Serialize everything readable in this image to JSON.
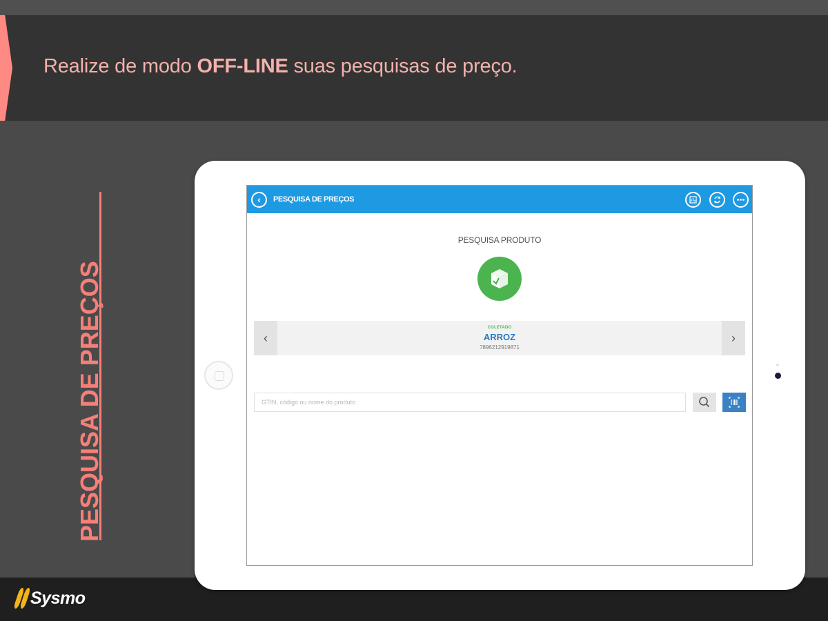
{
  "banner": {
    "text_before": "Realize de modo ",
    "text_bold": "OFF-LINE",
    "text_after": " suas pesquisas de preço."
  },
  "side_title": "PESQUISA DE PREÇOS",
  "brand": {
    "logo_text": "Sysmo"
  },
  "app": {
    "header_title": "PESQUISA DE PREÇOS",
    "section_title": "PESQUISA PRODUTO",
    "product": {
      "status_label": "COLETADO",
      "name": "ARROZ",
      "code": "7896212919871"
    },
    "search": {
      "placeholder": "GTIN, código ou nome do produto",
      "value": ""
    },
    "icons": {
      "back": "back-arrow-icon",
      "header_actions": [
        "chart-icon",
        "sync-icon",
        "more-icon"
      ],
      "product": "package-check-icon",
      "search": "search-icon",
      "scan": "barcode-scan-icon"
    }
  },
  "colors": {
    "accent": "#f77f79",
    "app_header": "#1e9ae3",
    "success": "#4cb44e",
    "product_name": "#2a79c2",
    "scan_button": "#3b82c4"
  }
}
